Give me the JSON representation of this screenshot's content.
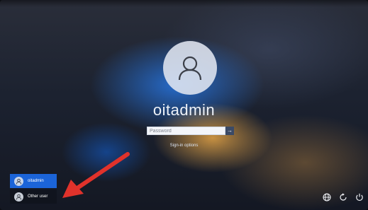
{
  "login": {
    "username": "oitadmin",
    "password_placeholder": "Password",
    "submit_glyph": "→",
    "sign_in_options": "Sign-in options"
  },
  "user_list": [
    {
      "name": "oitadmin",
      "selected": true
    },
    {
      "name": "Other user",
      "selected": false
    }
  ],
  "annotation": {
    "arrow_color": "#e0322b",
    "points_to": "Other user"
  },
  "system_icons": [
    "network-icon",
    "accessibility-icon",
    "power-icon"
  ],
  "colors": {
    "selected_user_tile": "#1b64d8",
    "avatar": "#e1e6f0"
  }
}
